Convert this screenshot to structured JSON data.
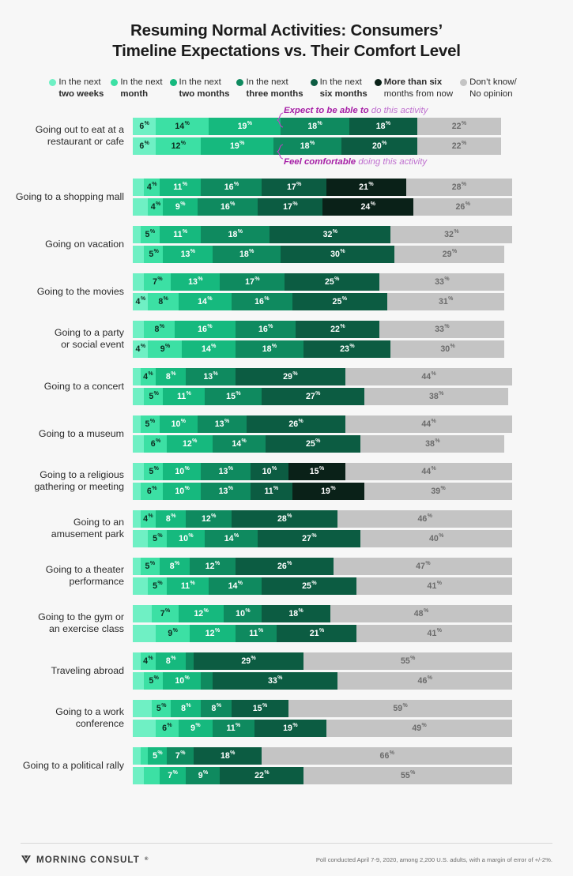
{
  "title": {
    "line1": "Resuming Normal Activities: Consumers’",
    "line2": "Timeline Expectations vs. Their Comfort Level"
  },
  "legend": [
    {
      "name": "in-the-next-two-weeks",
      "line1": "In the next",
      "line2": "two weeks",
      "line1_bold": false,
      "line2_bold": true,
      "color": "#6ff0c4"
    },
    {
      "name": "in-the-next-month",
      "line1": "In the next",
      "line2": "month",
      "line1_bold": false,
      "line2_bold": true,
      "color": "#3ce0a4"
    },
    {
      "name": "in-the-next-two-months",
      "line1": "In the next",
      "line2": "two months",
      "line1_bold": false,
      "line2_bold": true,
      "color": "#16b97e"
    },
    {
      "name": "in-the-next-three-months",
      "line1": "In the next",
      "line2": "three months",
      "line1_bold": false,
      "line2_bold": true,
      "color": "#0f8a5f"
    },
    {
      "name": "in-the-next-six-months",
      "line1": "In the next",
      "line2": "six months",
      "line1_bold": false,
      "line2_bold": true,
      "color": "#0c5c42"
    },
    {
      "name": "more-than-six-months",
      "line1": "More than six",
      "line2": "months from now",
      "line1_bold": true,
      "line2_bold": false,
      "color": "#0a2118"
    },
    {
      "name": "dont-know-no-opinion",
      "line1": "Don’t know/",
      "line2": "No opinion",
      "line1_bold": false,
      "line2_bold": false,
      "color": "#c4c4c4"
    }
  ],
  "annotations": {
    "expect_bold": "Expect to be able to",
    "expect_rest": " do this activity",
    "comfort_bold": "Feel comfortable",
    "comfort_rest": " doing this activity"
  },
  "series_names": [
    "Expect to be able to do this activity",
    "Feel comfortable doing this activity"
  ],
  "chart_data": {
    "type": "bar",
    "subtype": "stacked-horizontal-100pct",
    "title": "Resuming Normal Activities: Consumers’ Timeline Expectations vs. Their Comfort Level",
    "xlabel": "",
    "ylabel": "",
    "xlim": [
      0,
      100
    ],
    "grid": false,
    "legend_position": "top",
    "unit": "%",
    "segment_labels": [
      "In the next two weeks",
      "In the next month",
      "In the next two months",
      "In the next three months",
      "In the next six months",
      "More than six months from now",
      "Don’t know/No opinion"
    ],
    "segment_colors": [
      "#6ff0c4",
      "#3ce0a4",
      "#16b97e",
      "#0f8a5f",
      "#0c5c42",
      "#0a2118",
      "#c4c4c4"
    ],
    "rows": [
      {
        "category": "Going out to eat at a restaurant or cafe",
        "label_lines": [
          "Going out to eat at a",
          "restaurant or cafe"
        ],
        "expect": {
          "values": [
            6,
            14,
            19,
            18,
            18,
            0,
            22
          ],
          "shown": [
            6,
            14,
            19,
            18,
            18,
            null,
            22
          ]
        },
        "comfort": {
          "values": [
            6,
            12,
            19,
            18,
            20,
            0,
            22
          ],
          "shown": [
            6,
            12,
            19,
            18,
            20,
            null,
            22
          ]
        }
      },
      {
        "category": "Going to a shopping mall",
        "label_lines": [
          "Going to a shopping mall"
        ],
        "expect": {
          "values": [
            3,
            4,
            11,
            16,
            17,
            21,
            28
          ],
          "shown": [
            null,
            4,
            11,
            16,
            17,
            21,
            28
          ]
        },
        "comfort": {
          "values": [
            4,
            4,
            9,
            16,
            17,
            24,
            26
          ],
          "shown": [
            null,
            4,
            9,
            16,
            17,
            24,
            26
          ]
        }
      },
      {
        "category": "Going on vacation",
        "label_lines": [
          "Going on vacation"
        ],
        "expect": {
          "values": [
            2,
            5,
            11,
            18,
            32,
            0,
            32
          ],
          "shown": [
            null,
            5,
            11,
            18,
            32,
            null,
            32
          ]
        },
        "comfort": {
          "values": [
            3,
            5,
            13,
            18,
            30,
            0,
            29
          ],
          "shown": [
            null,
            5,
            13,
            18,
            30,
            null,
            29
          ]
        }
      },
      {
        "category": "Going to the movies",
        "label_lines": [
          "Going to the movies"
        ],
        "expect": {
          "values": [
            3,
            7,
            13,
            17,
            25,
            0,
            33
          ],
          "shown": [
            null,
            7,
            13,
            17,
            25,
            null,
            33
          ]
        },
        "comfort": {
          "values": [
            4,
            8,
            14,
            16,
            25,
            0,
            31
          ],
          "shown": [
            4,
            8,
            14,
            16,
            25,
            null,
            31
          ]
        }
      },
      {
        "category": "Going to a party or social event",
        "label_lines": [
          "Going to a party",
          "or social event"
        ],
        "expect": {
          "values": [
            3,
            8,
            16,
            16,
            22,
            0,
            33
          ],
          "shown": [
            null,
            8,
            16,
            16,
            22,
            null,
            33
          ]
        },
        "comfort": {
          "values": [
            4,
            9,
            14,
            18,
            23,
            0,
            30
          ],
          "shown": [
            4,
            9,
            14,
            18,
            23,
            null,
            30
          ]
        }
      },
      {
        "category": "Going to a concert",
        "label_lines": [
          "Going to a concert"
        ],
        "expect": {
          "values": [
            2,
            4,
            8,
            13,
            29,
            0,
            44
          ],
          "shown": [
            null,
            4,
            8,
            13,
            29,
            null,
            44
          ]
        },
        "comfort": {
          "values": [
            3,
            5,
            11,
            15,
            27,
            0,
            38
          ],
          "shown": [
            null,
            5,
            11,
            15,
            27,
            null,
            38
          ]
        }
      },
      {
        "category": "Going to a museum",
        "label_lines": [
          "Going to a museum"
        ],
        "expect": {
          "values": [
            2,
            5,
            10,
            13,
            26,
            0,
            44
          ],
          "shown": [
            null,
            5,
            10,
            13,
            26,
            null,
            44
          ]
        },
        "comfort": {
          "values": [
            3,
            6,
            12,
            14,
            25,
            0,
            38
          ],
          "shown": [
            null,
            6,
            12,
            14,
            25,
            null,
            38
          ]
        }
      },
      {
        "category": "Going to a religious gathering or meeting",
        "label_lines": [
          "Going to a religious",
          "gathering or meeting"
        ],
        "expect": {
          "values": [
            3,
            5,
            10,
            13,
            10,
            15,
            44
          ],
          "shown": [
            null,
            5,
            10,
            13,
            10,
            15,
            44
          ]
        },
        "comfort": {
          "values": [
            2,
            6,
            10,
            13,
            11,
            19,
            39
          ],
          "shown": [
            null,
            6,
            10,
            13,
            11,
            19,
            39
          ]
        }
      },
      {
        "category": "Going to an amusement park",
        "label_lines": [
          "Going to an",
          "amusement park"
        ],
        "expect": {
          "values": [
            2,
            4,
            8,
            12,
            28,
            0,
            46
          ],
          "shown": [
            null,
            4,
            8,
            12,
            28,
            null,
            46
          ]
        },
        "comfort": {
          "values": [
            4,
            5,
            10,
            14,
            27,
            0,
            40
          ],
          "shown": [
            null,
            5,
            10,
            14,
            27,
            null,
            40
          ]
        }
      },
      {
        "category": "Going to a theater performance",
        "label_lines": [
          "Going to a theater",
          "performance"
        ],
        "expect": {
          "values": [
            2,
            5,
            8,
            12,
            26,
            0,
            47
          ],
          "shown": [
            null,
            5,
            8,
            12,
            26,
            null,
            47
          ]
        },
        "comfort": {
          "values": [
            4,
            5,
            11,
            14,
            25,
            0,
            41
          ],
          "shown": [
            null,
            5,
            11,
            14,
            25,
            null,
            41
          ]
        }
      },
      {
        "category": "Going to the gym or an exercise class",
        "label_lines": [
          "Going to the gym or",
          "an exercise class"
        ],
        "expect": {
          "values": [
            5,
            7,
            12,
            10,
            18,
            0,
            48
          ],
          "shown": [
            null,
            7,
            12,
            10,
            18,
            null,
            48
          ]
        },
        "comfort": {
          "values": [
            6,
            9,
            12,
            11,
            21,
            0,
            41
          ],
          "shown": [
            null,
            9,
            12,
            11,
            21,
            null,
            41
          ]
        }
      },
      {
        "category": "Traveling abroad",
        "label_lines": [
          "Traveling abroad"
        ],
        "expect": {
          "values": [
            2,
            4,
            8,
            2,
            29,
            0,
            55
          ],
          "shown": [
            null,
            4,
            8,
            null,
            29,
            null,
            55
          ]
        },
        "comfort": {
          "values": [
            3,
            5,
            10,
            3,
            33,
            0,
            46
          ],
          "shown": [
            null,
            5,
            10,
            null,
            33,
            null,
            46
          ]
        }
      },
      {
        "category": "Going to a work conference",
        "label_lines": [
          "Going to a work",
          "conference"
        ],
        "expect": {
          "values": [
            5,
            5,
            8,
            8,
            15,
            0,
            59
          ],
          "shown": [
            null,
            5,
            8,
            8,
            15,
            null,
            59
          ]
        },
        "comfort": {
          "values": [
            6,
            6,
            9,
            11,
            19,
            0,
            49
          ],
          "shown": [
            null,
            6,
            9,
            11,
            19,
            null,
            49
          ]
        }
      },
      {
        "category": "Going to a political rally",
        "label_lines": [
          "Going to a political rally"
        ],
        "expect": {
          "values": [
            2,
            2,
            5,
            7,
            18,
            0,
            66
          ],
          "shown": [
            null,
            null,
            5,
            7,
            18,
            null,
            66
          ]
        },
        "comfort": {
          "values": [
            3,
            4,
            7,
            9,
            22,
            0,
            55
          ],
          "shown": [
            null,
            null,
            7,
            9,
            22,
            null,
            55
          ]
        }
      }
    ]
  },
  "footer": {
    "brand": "MORNING CONSULT",
    "brand_mark": "®",
    "source": "Poll conducted April 7-9, 2020, among 2,200 U.S. adults, with a margin of error of +/-2%."
  }
}
